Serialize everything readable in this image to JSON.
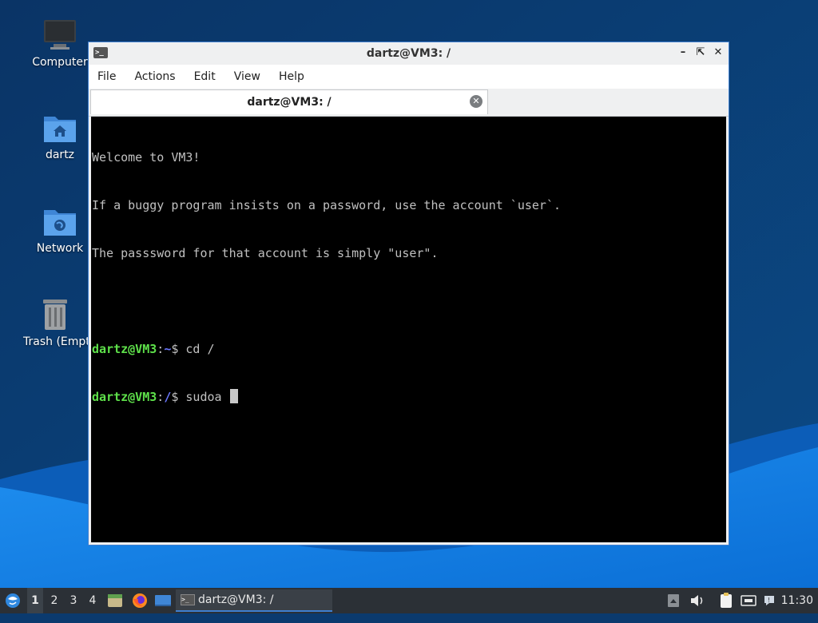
{
  "desktop": {
    "icons": [
      {
        "label": "Computer"
      },
      {
        "label": "dartz"
      },
      {
        "label": "Network"
      },
      {
        "label": "Trash (Empt"
      }
    ]
  },
  "window": {
    "title": "dartz@VM3: /",
    "menu": [
      "File",
      "Actions",
      "Edit",
      "View",
      "Help"
    ],
    "tab_title": "dartz@VM3: /"
  },
  "terminal": {
    "lines": [
      "Welcome to VM3!",
      "If a buggy program insists on a password, use the account `user`.",
      "The passsword for that account is simply \"user\".",
      ""
    ],
    "prompts": [
      {
        "user": "dartz@VM3",
        "sep": ":",
        "path": "~",
        "symbol": "$ ",
        "cmd": "cd /"
      },
      {
        "user": "dartz@VM3",
        "sep": ":",
        "path": "/",
        "symbol": "$ ",
        "cmd": "sudoa "
      }
    ],
    "colors": {
      "user": "#5ee04a",
      "path": "#6b78ff",
      "text": "#c0c0c0",
      "bg": "#000000"
    }
  },
  "taskbar": {
    "workspaces": [
      "1",
      "2",
      "3",
      "4"
    ],
    "active_workspace": "1",
    "task_label": "dartz@VM3: /",
    "clock": "11:30",
    "launchers": [
      "file-manager-icon",
      "firefox-icon",
      "desktop-icon"
    ],
    "tray": [
      "tray-up-icon",
      "volume-icon",
      "clipboard-icon",
      "network-icon",
      "notification-icon"
    ]
  }
}
